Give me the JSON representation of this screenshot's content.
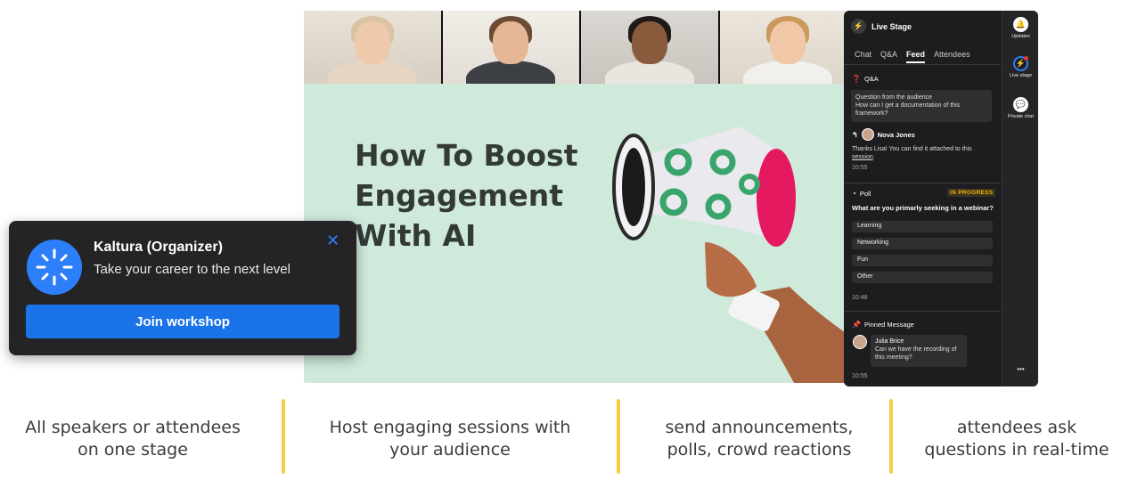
{
  "stage": {
    "title_lines": [
      "How To Boost",
      "Engagement",
      "With AI"
    ]
  },
  "panel": {
    "header_title": "Live Stage",
    "tabs": [
      "Chat",
      "Q&A",
      "Feed",
      "Attendees"
    ],
    "active_tab": "Feed",
    "qa": {
      "section_label": "Q&A",
      "question_line1": "Question from the audience",
      "question_line2": "How can I get a documentation of this",
      "question_line3": "framework?",
      "responder": "Nova Jones",
      "answer_line1": "Thanks Lisa! You can find it attached to this",
      "answer_link": "session",
      "answer_end": ".",
      "time": "10:55"
    },
    "poll": {
      "section_label": "Poll",
      "status": "IN PROGRESS",
      "question": "What are you primarly seeking in a webinar?",
      "options": [
        "Learning",
        "Networking",
        "Fun",
        "Other"
      ],
      "time": "10:48"
    },
    "pinned": {
      "section_label": "Pinned Message",
      "author": "Julia Brice",
      "message_line1": "Can we have the recording of",
      "message_line2": "this meeting?",
      "time": "10:55"
    },
    "rail": {
      "updates": "Updates",
      "live_stage": "Live stage",
      "private_chat": "Private chat",
      "more": "•••"
    }
  },
  "notification": {
    "title": "Kaltura (Organizer)",
    "subtitle": "Take your career to the next level",
    "button_label": "Join workshop",
    "close": "✕"
  },
  "captions": [
    {
      "line1": "All speakers or attendees",
      "line2": "on one stage"
    },
    {
      "line1": "Host engaging sessions with",
      "line2": "your audience"
    },
    {
      "line1": "send announcements,",
      "line2": "polls, crowd reactions"
    },
    {
      "line1": "attendees ask",
      "line2": "questions in real-time"
    }
  ],
  "colors": {
    "accent_blue": "#2d7ff9",
    "stage_bg": "#cfe9db",
    "divider_yellow": "#f6cd44",
    "megaphone_green": "#39a56b",
    "megaphone_pink": "#e5195f"
  }
}
